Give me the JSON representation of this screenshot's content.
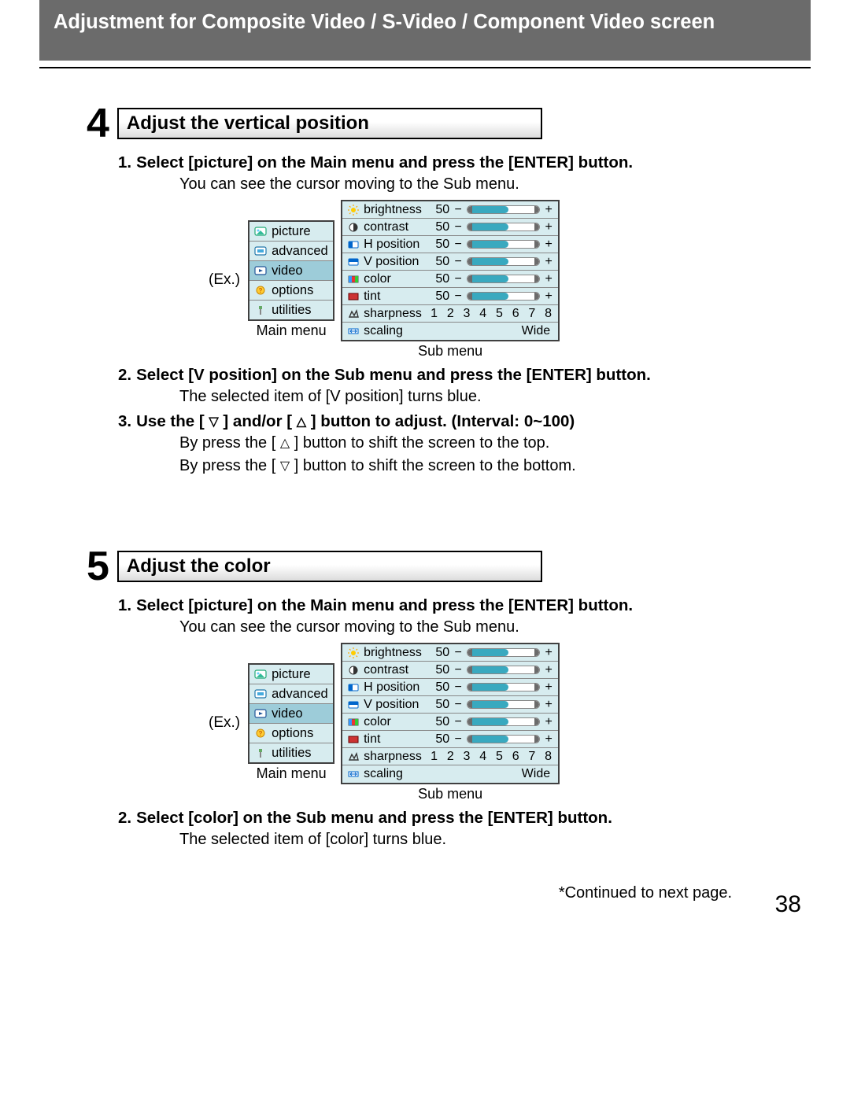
{
  "header_title": "Adjustment for Composite Video / S-Video / Component Video screen",
  "page_number": "38",
  "continued_label": "*Continued to next page.",
  "labels": {
    "ex": "(Ex.)",
    "main_menu_caption": "Main menu",
    "sub_menu_caption": "Sub menu"
  },
  "main_menu_items": [
    "picture",
    "advanced",
    "video",
    "options",
    "utilities"
  ],
  "sub_menu": {
    "rows": [
      {
        "name": "brightness",
        "value": "50",
        "fill": 50
      },
      {
        "name": "contrast",
        "value": "50",
        "fill": 50
      },
      {
        "name": "H position",
        "value": "50",
        "fill": 50
      },
      {
        "name": "V position",
        "value": "50",
        "fill": 50
      },
      {
        "name": "color",
        "value": "50",
        "fill": 50
      },
      {
        "name": "tint",
        "value": "50",
        "fill": 50
      }
    ],
    "sharpness_label": "sharpness",
    "sharpness_scale": [
      "1",
      "2",
      "3",
      "4",
      "5",
      "6",
      "7",
      "8"
    ],
    "scaling_label": "scaling",
    "scaling_value": "Wide"
  },
  "section4": {
    "number": "4",
    "title": "Adjust the vertical position",
    "step1_num": "1.",
    "step1_pre": "Select [",
    "step1_chip": "picture",
    "step1_post": "] on the Main menu and press the [ENTER] button.",
    "step1_sub": "You can see the cursor moving to the Sub menu.",
    "step2_num": "2.",
    "step2_pre": "Select [",
    "step2_chip": "V position",
    "step2_post": "] on the Sub menu and press the [ENTER] button.",
    "step2_sub_pre": "The selected item of [",
    "step2_sub_chip": "V position",
    "step2_sub_post": "] turns blue.",
    "step3_num": "3.",
    "step3_pre": "Use the [ ",
    "step3_mid": " ] and/or [ ",
    "step3_post": " ] button to adjust. (Interval: 0~100)",
    "step3_sub1_pre": "By press the [ ",
    "step3_sub1_post": " ] button to shift the screen to the top.",
    "step3_sub2_pre": "By press the [ ",
    "step3_sub2_post": " ] button to shift the screen to the bottom."
  },
  "section5": {
    "number": "5",
    "title": "Adjust the color",
    "step1_num": "1.",
    "step1_pre": "Select [",
    "step1_chip": "picture",
    "step1_post": "] on the Main menu and press the [ENTER] button.",
    "step1_sub": "You can see the cursor moving to the Sub menu.",
    "step2_num": "2.",
    "step2_pre": "Select [",
    "step2_chip": "color",
    "step2_post": "] on the Sub menu and press the [ENTER] button.",
    "step2_sub_pre": "The selected item of [",
    "step2_sub_chip": "color",
    "step2_sub_post": "] turns blue."
  }
}
